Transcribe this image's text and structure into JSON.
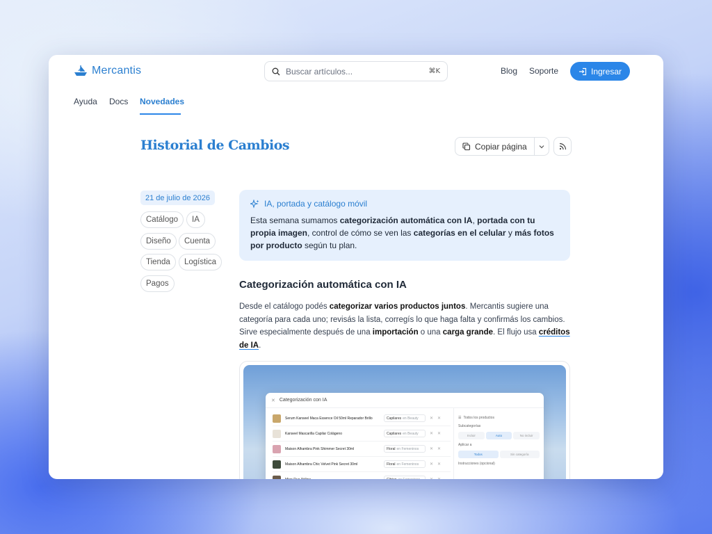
{
  "header": {
    "brand": "Mercantis",
    "search_placeholder": "Buscar artículos...",
    "search_shortcut": "⌘K",
    "nav": [
      "Blog",
      "Soporte"
    ],
    "login_label": "Ingresar"
  },
  "tabs": [
    {
      "label": "Ayuda",
      "active": false
    },
    {
      "label": "Docs",
      "active": false
    },
    {
      "label": "Novedades",
      "active": true
    }
  ],
  "page": {
    "title": "Historial de Cambios",
    "copy_label": "Copiar página"
  },
  "entry": {
    "date": "21 de julio de 2026",
    "tags": [
      "Catálogo",
      "IA",
      "Diseño",
      "Cuenta",
      "Tienda",
      "Logística",
      "Pagos"
    ],
    "callout": {
      "title": "IA, portada y catálogo móvil",
      "parts": [
        "Esta semana sumamos ",
        "categorización automática con IA",
        ", ",
        "portada con tu propia imagen",
        ", control de cómo se ven las ",
        "categorías en el celular",
        " y ",
        "más fotos por producto",
        " según tu plan."
      ]
    },
    "section_title": "Categorización automática con IA",
    "paragraph": {
      "parts": [
        "Desde el catálogo podés ",
        "categorizar varios productos juntos",
        ". Mercantis sugiere una categoría para cada uno; revisás la lista, corregís lo que haga falta y confirmás los cambios. Sirve especialmente después de una ",
        "importación",
        " o una ",
        "carga grande",
        ". El flujo usa ",
        "créditos de IA",
        "."
      ]
    }
  },
  "screenshot": {
    "modal_title": "Categorización con IA",
    "rows": [
      {
        "name": "Serum Kanseel Maca Essence Oil 50ml Reparador Brillo",
        "category": "Capilares",
        "group": "en Beauty",
        "thumb_color": "#c9a76b"
      },
      {
        "name": "Kanseel Mascarilla Capilar Colágeno",
        "category": "Capilares",
        "group": "en Beauty",
        "thumb_color": "#e8e2d8"
      },
      {
        "name": "Maison Alhambra Pink Shimmer Secret 30ml",
        "category": "Floral",
        "group": "en Femeninos",
        "thumb_color": "#d9a3b0"
      },
      {
        "name": "Maison Alhambra Chic Velvet Pink Secret 30ml",
        "category": "Floral",
        "group": "en Femeninos",
        "thumb_color": "#3d4a3a"
      },
      {
        "name": "Mion Rua Yellow",
        "category": "Cítrico",
        "group": "en Femeninos",
        "thumb_color": "#6a5b4a"
      }
    ],
    "right_panel": {
      "all_products": "Todos los productos",
      "subcategories_label": "Subcategorías",
      "subcategory_options": [
        "Incluir",
        "Auto",
        "No incluir"
      ],
      "apply_label": "Aplicar a",
      "apply_options": [
        "Todos",
        "Sin categoría"
      ],
      "instructions_label": "Instrucciones (opcional)"
    }
  },
  "colors": {
    "accent": "#2b86e8",
    "brand_text": "#2b7fd0",
    "callout_bg": "#e6f0fd"
  }
}
